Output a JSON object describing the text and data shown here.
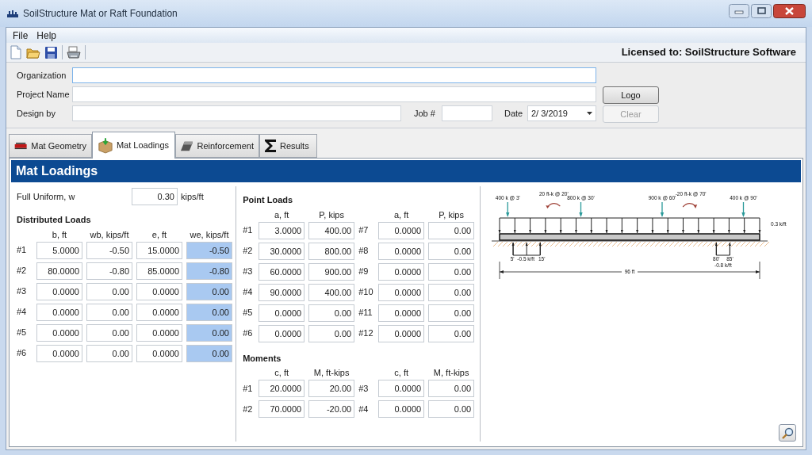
{
  "window": {
    "title": "SoilStructure Mat or Raft Foundation"
  },
  "menu": [
    "File",
    "Help"
  ],
  "license": "Licensed to: SoilStructure Software",
  "form": {
    "organization_label": "Organization",
    "project_label": "Project Name",
    "design_label": "Design by",
    "job_label": "Job #",
    "date_label": "Date",
    "date_value": "2/ 3/2019"
  },
  "buttons": [
    {
      "label": "Logo",
      "disabled": false
    },
    {
      "label": "Clear",
      "disabled": true
    }
  ],
  "tabs": [
    {
      "label": "Mat Geometry",
      "kind": "geometry",
      "selected": false
    },
    {
      "label": "Mat Loadings",
      "kind": "loadings",
      "selected": true
    },
    {
      "label": "Reinforcement",
      "kind": "reinforcement",
      "selected": false
    },
    {
      "label": "Results",
      "kind": "results",
      "selected": false
    }
  ],
  "panel_title": "Mat Loadings",
  "full_uniform": {
    "label": "Full Uniform, w",
    "value": "0.30",
    "unit": "kips/ft"
  },
  "distributed_loads": {
    "title": "Distributed Loads",
    "columns": [
      "b, ft",
      "wb, kips/ft",
      "e, ft",
      "we, kips/ft"
    ],
    "rows": [
      {
        "label": "#1",
        "values": [
          "5.0000",
          "-0.50",
          "15.0000",
          "-0.50"
        ]
      },
      {
        "label": "#2",
        "values": [
          "80.0000",
          "-0.80",
          "85.0000",
          "-0.80"
        ]
      },
      {
        "label": "#3",
        "values": [
          "0.0000",
          "0.00",
          "0.0000",
          "0.00"
        ]
      },
      {
        "label": "#4",
        "values": [
          "0.0000",
          "0.00",
          "0.0000",
          "0.00"
        ]
      },
      {
        "label": "#5",
        "values": [
          "0.0000",
          "0.00",
          "0.0000",
          "0.00"
        ]
      },
      {
        "label": "#6",
        "values": [
          "0.0000",
          "0.00",
          "0.0000",
          "0.00"
        ]
      }
    ]
  },
  "point_loads": {
    "title": "Point Loads",
    "columns": [
      "a, ft",
      "P, kips",
      "a, ft",
      "P, kips"
    ],
    "rows": [
      {
        "label": "#1",
        "a": "3.0000",
        "p": "400.00"
      },
      {
        "label": "#2",
        "a": "30.0000",
        "p": "800.00"
      },
      {
        "label": "#3",
        "a": "60.0000",
        "p": "900.00"
      },
      {
        "label": "#4",
        "a": "90.0000",
        "p": "400.00"
      },
      {
        "label": "#5",
        "a": "0.0000",
        "p": "0.00"
      },
      {
        "label": "#6",
        "a": "0.0000",
        "p": "0.00"
      },
      {
        "label": "#7",
        "a": "0.0000",
        "p": "0.00"
      },
      {
        "label": "#8",
        "a": "0.0000",
        "p": "0.00"
      },
      {
        "label": "#9",
        "a": "0.0000",
        "p": "0.00"
      },
      {
        "label": "#10",
        "a": "0.0000",
        "p": "0.00"
      },
      {
        "label": "#11",
        "a": "0.0000",
        "p": "0.00"
      },
      {
        "label": "#12",
        "a": "0.0000",
        "p": "0.00"
      }
    ]
  },
  "moments": {
    "title": "Moments",
    "columns": [
      "c, ft",
      "M, ft-kips",
      "c, ft",
      "M, ft-kips"
    ],
    "rows": [
      {
        "label": "#1",
        "c": "20.0000",
        "m": "20.00"
      },
      {
        "label": "#2",
        "c": "70.0000",
        "m": "-20.00"
      },
      {
        "label": "#3",
        "c": "0.0000",
        "m": "0.00"
      },
      {
        "label": "#4",
        "c": "0.0000",
        "m": "0.00"
      }
    ]
  },
  "diagram": {
    "point_labels": [
      "400 k @ 3'",
      "800 k @ 30'",
      "900 k @ 60'",
      "400 k @ 90'"
    ],
    "moment_labels": [
      "20 ft-k @ 20'",
      "-20 ft-k @ 70'"
    ],
    "uniform_label": "0.3 k/ft",
    "distributed_labels": [
      {
        "start": "5'",
        "end": "15'",
        "load": "-0.5 k/ft"
      },
      {
        "start": "80'",
        "end": "85'",
        "load": "-0.8 k/ft"
      }
    ],
    "span_label": "96 ft"
  }
}
